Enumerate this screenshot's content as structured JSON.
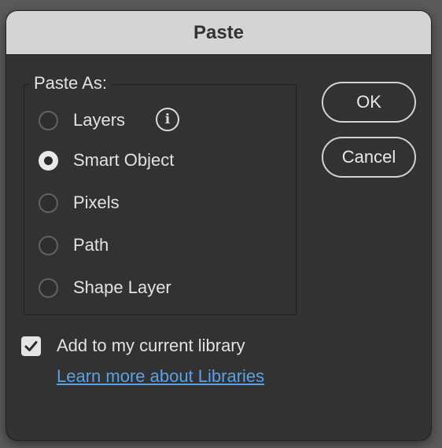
{
  "dialog": {
    "title": "Paste",
    "paste_as": {
      "legend": "Paste As:",
      "options": [
        {
          "label": "Layers",
          "selected": false
        },
        {
          "label": "Smart Object",
          "selected": true
        },
        {
          "label": "Pixels",
          "selected": false
        },
        {
          "label": "Path",
          "selected": false
        },
        {
          "label": "Shape Layer",
          "selected": false
        }
      ],
      "info_glyph": "i",
      "info_icon": "info-circle-icon"
    },
    "buttons": {
      "ok_label": "OK",
      "cancel_label": "Cancel"
    },
    "library": {
      "checkbox_label": "Add to my current library",
      "checked": true,
      "link_text": "Learn more about Libraries"
    },
    "colors": {
      "background": "#323232",
      "titlebar": "#d4d4d4",
      "link": "#5aa1e8"
    }
  }
}
